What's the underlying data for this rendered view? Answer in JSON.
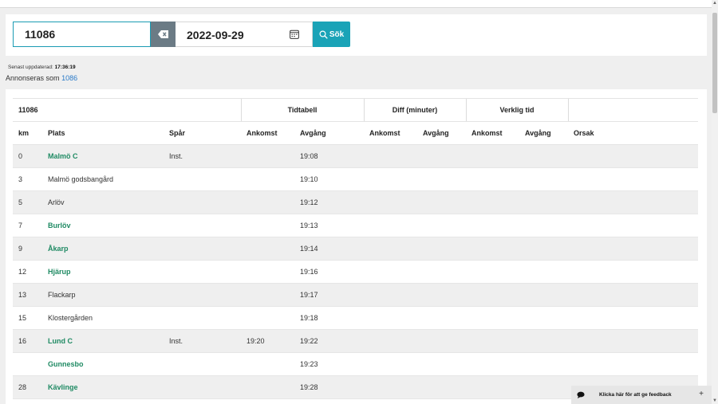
{
  "search": {
    "train_number": "11086",
    "date": "2022-09-29",
    "search_label": "Sök"
  },
  "status": {
    "updated_label": "Senast uppdaterad:",
    "updated_time": "17:36:19",
    "announced_label": "Annonseras som",
    "announced_value": "1086"
  },
  "table": {
    "train_id": "11086",
    "group_timetable": "Tidtabell",
    "group_diff": "Diff (minuter)",
    "group_actual": "Verklig tid",
    "col_km": "km",
    "col_place": "Plats",
    "col_track": "Spår",
    "col_arrival": "Ankomst",
    "col_departure": "Avgång",
    "col_reason": "Orsak",
    "rows": [
      {
        "km": "0",
        "place": "Malmö C",
        "link": true,
        "track": "Inst.",
        "arr": "",
        "dep": "19:08"
      },
      {
        "km": "3",
        "place": "Malmö godsbangård",
        "link": false,
        "track": "",
        "arr": "",
        "dep": "19:10"
      },
      {
        "km": "5",
        "place": "Arlöv",
        "link": false,
        "track": "",
        "arr": "",
        "dep": "19:12"
      },
      {
        "km": "7",
        "place": "Burlöv",
        "link": true,
        "track": "",
        "arr": "",
        "dep": "19:13"
      },
      {
        "km": "9",
        "place": "Åkarp",
        "link": true,
        "track": "",
        "arr": "",
        "dep": "19:14"
      },
      {
        "km": "12",
        "place": "Hjärup",
        "link": true,
        "track": "",
        "arr": "",
        "dep": "19:16"
      },
      {
        "km": "13",
        "place": "Flackarp",
        "link": false,
        "track": "",
        "arr": "",
        "dep": "19:17"
      },
      {
        "km": "15",
        "place": "Klostergården",
        "link": false,
        "track": "",
        "arr": "",
        "dep": "19:18"
      },
      {
        "km": "16",
        "place": "Lund C",
        "link": true,
        "track": "Inst.",
        "arr": "19:20",
        "dep": "19:22"
      },
      {
        "km": "",
        "place": "Gunnesbo",
        "link": true,
        "track": "",
        "arr": "",
        "dep": "19:23"
      },
      {
        "km": "28",
        "place": "Kävlinge",
        "link": true,
        "track": "",
        "arr": "",
        "dep": "19:28"
      }
    ]
  },
  "feedback": {
    "label": "Klicka här för att ge feedback",
    "plus": "+"
  },
  "colors": {
    "accent": "#1aa3b7",
    "station_link": "#1f8a63",
    "announced_link": "#2a7ac8"
  }
}
